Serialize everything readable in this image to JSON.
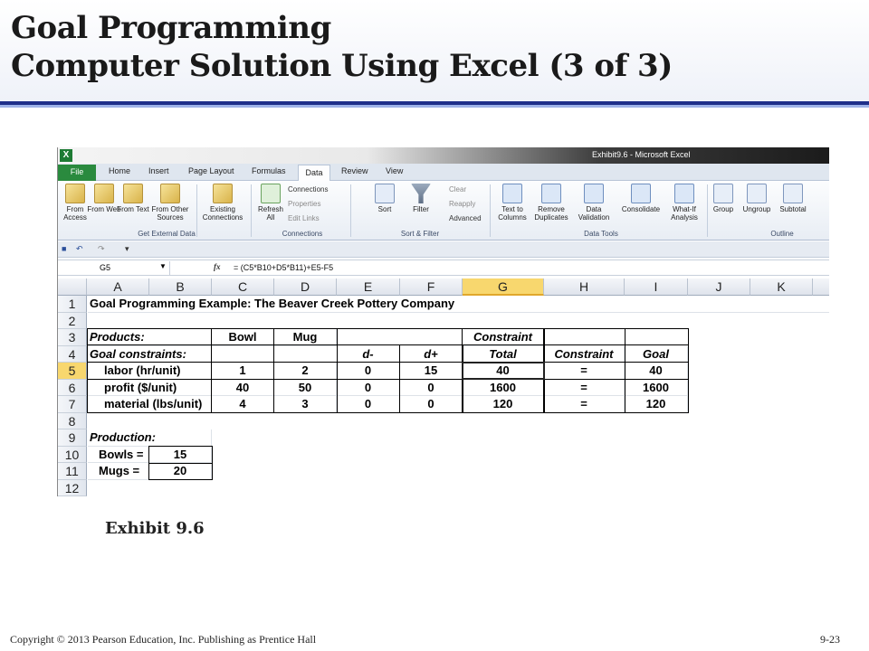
{
  "slide": {
    "title_line1": "Goal Programming",
    "title_line2": "Computer Solution Using Excel (3 of  3)",
    "caption": "Exhibit 9.6",
    "footer_left": "Copyright © 2013 Pearson Education, Inc. Publishing as Prentice Hall",
    "footer_right": "9-23",
    "accent_color": "#1f2f8a"
  },
  "excel": {
    "window_title": "Exhibit9.6  -  Microsoft Excel",
    "tabs": [
      "File",
      "Home",
      "Insert",
      "Page Layout",
      "Formulas",
      "Data",
      "Review",
      "View"
    ],
    "active_tab": "Data",
    "ribbon": {
      "from_access": "From Access",
      "from_web": "From Web",
      "from_text": "From Text",
      "from_other": "From Other Sources",
      "existing": "Existing Connections",
      "refresh": "Refresh All",
      "connections": "Connections",
      "properties": "Properties",
      "edit_links": "Edit Links",
      "sort": "Sort",
      "filter": "Filter",
      "clear": "Clear",
      "reapply": "Reapply",
      "advanced": "Advanced",
      "text_to_columns": "Text to Columns",
      "remove_duplicates": "Remove Duplicates",
      "data_validation": "Data Validation",
      "consolidate": "Consolidate",
      "what_if": "What-If Analysis",
      "group": "Group",
      "ungroup": "Ungroup",
      "subtotal": "Subtotal",
      "group_labels": [
        "Get External Data",
        "Connections",
        "Sort & Filter",
        "Data Tools",
        "Outline"
      ]
    },
    "name_box": "G5",
    "fx": "fx",
    "formula": "= (C5*B10+D5*B11)+E5-F5",
    "columns": [
      "A",
      "B",
      "C",
      "D",
      "E",
      "F",
      "G",
      "H",
      "I",
      "J",
      "K"
    ],
    "rows": [
      "1",
      "2",
      "3",
      "4",
      "5",
      "6",
      "7",
      "8",
      "9",
      "10",
      "11",
      "12"
    ],
    "selected_cell": "G5",
    "cells": {
      "a1": "Goal Programming Example: The Beaver Creek Pottery Company",
      "a3": "Products:",
      "c3": "Bowl",
      "d3": "Mug",
      "g3": "Constraint",
      "a4": "Goal constraints:",
      "e4": "d-",
      "f4": "d+",
      "g4": "Total",
      "h4": "Constraint",
      "i4": "Goal",
      "a5": "labor (hr/unit)",
      "c5": "1",
      "d5": "2",
      "e5": "0",
      "f5": "15",
      "g5": "40",
      "h5": "=",
      "i5": "40",
      "a6": "profit ($/unit)",
      "c6": "40",
      "d6": "50",
      "e6": "0",
      "f6": "0",
      "g6": "1600",
      "h6": "=",
      "i6": "1600",
      "a7": "material (lbs/unit)",
      "c7": "4",
      "d7": "3",
      "e7": "0",
      "f7": "0",
      "g7": "120",
      "h7": "=",
      "i7": "120",
      "a9": "Production:",
      "a10": "Bowls =",
      "b10": "15",
      "a11": "Mugs =",
      "b11": "20"
    }
  }
}
